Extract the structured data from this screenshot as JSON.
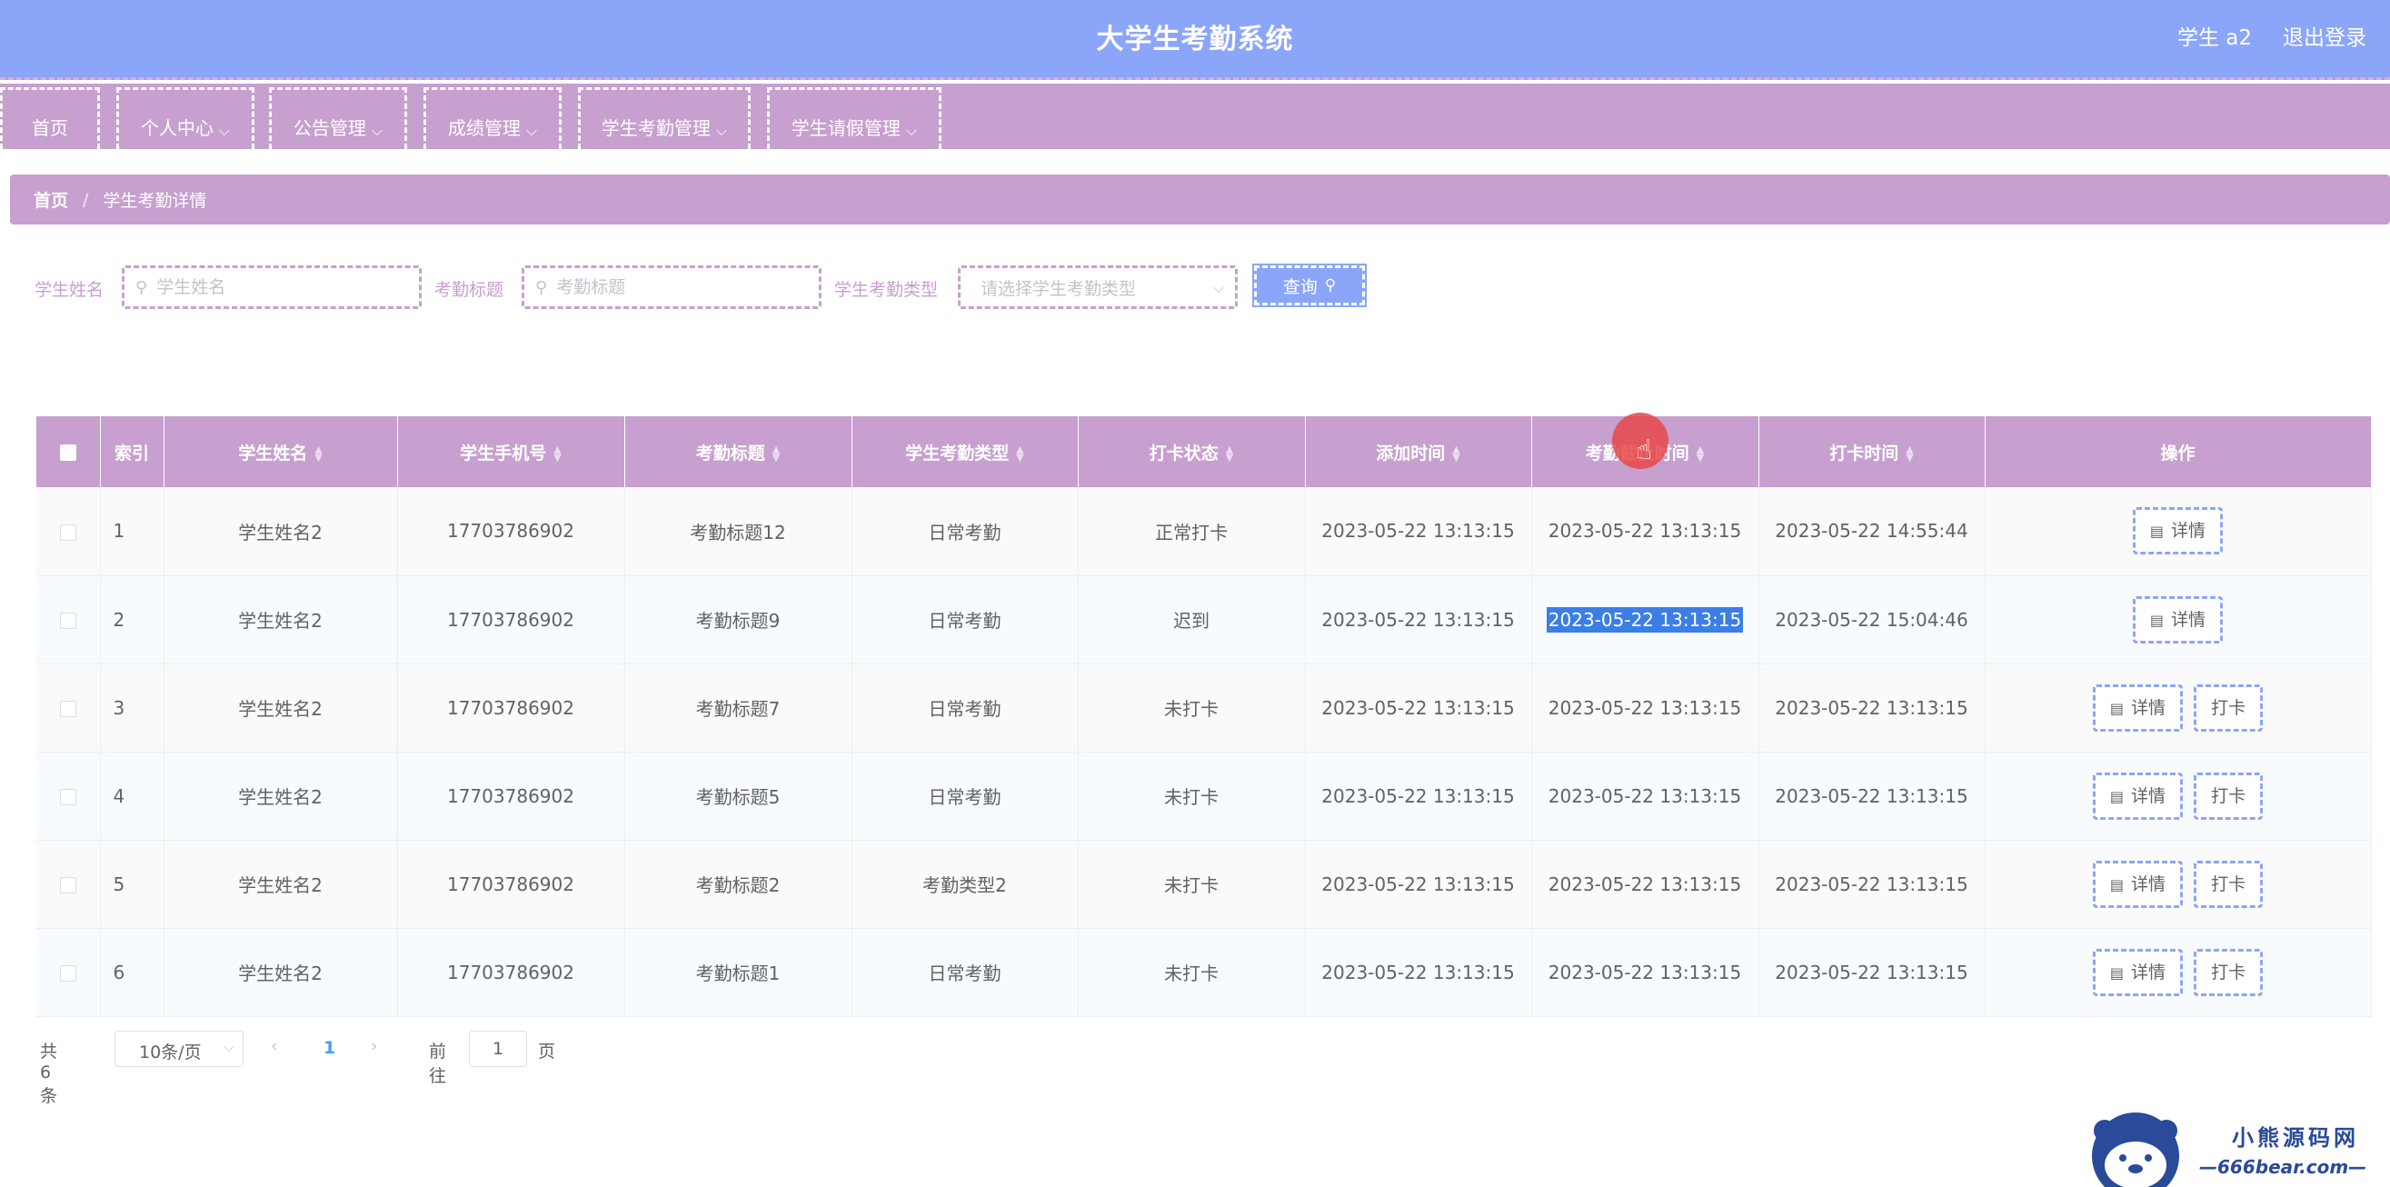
{
  "header": {
    "title": "大学生考勤系统",
    "user": "学生 a2",
    "logout": "退出登录"
  },
  "nav": {
    "items": [
      {
        "label": "首页",
        "dropdown": false
      },
      {
        "label": "个人中心",
        "dropdown": true
      },
      {
        "label": "公告管理",
        "dropdown": true
      },
      {
        "label": "成绩管理",
        "dropdown": true
      },
      {
        "label": "学生考勤管理",
        "dropdown": true
      },
      {
        "label": "学生请假管理",
        "dropdown": true
      }
    ]
  },
  "breadcrumb": {
    "home": "首页",
    "separator": "/",
    "current": "学生考勤详情"
  },
  "search": {
    "name_label": "学生姓名",
    "name_placeholder": "学生姓名",
    "title_label": "考勤标题",
    "title_placeholder": "考勤标题",
    "type_label": "学生考勤类型",
    "type_placeholder": "请选择学生考勤类型",
    "query_button": "查询"
  },
  "table": {
    "columns": [
      "索引",
      "学生姓名",
      "学生手机号",
      "考勤标题",
      "学生考勤类型",
      "打卡状态",
      "添加时间",
      "考勤截止时间",
      "打卡时间",
      "操作"
    ],
    "rows": [
      {
        "index": "1",
        "name": "学生姓名2",
        "phone": "17703786902",
        "title": "考勤标题12",
        "type": "日常考勤",
        "status": "正常打卡",
        "added": "2023-05-22 13:13:15",
        "deadline": "2023-05-22 13:13:15",
        "punch_time": "2023-05-22 14:55:44",
        "actions": [
          "详情"
        ]
      },
      {
        "index": "2",
        "name": "学生姓名2",
        "phone": "17703786902",
        "title": "考勤标题9",
        "type": "日常考勤",
        "status": "迟到",
        "added": "2023-05-22 13:13:15",
        "deadline": "2023-05-22 13:13:15",
        "punch_time": "2023-05-22 15:04:46",
        "actions": [
          "详情"
        ]
      },
      {
        "index": "3",
        "name": "学生姓名2",
        "phone": "17703786902",
        "title": "考勤标题7",
        "type": "日常考勤",
        "status": "未打卡",
        "added": "2023-05-22 13:13:15",
        "deadline": "2023-05-22 13:13:15",
        "punch_time": "2023-05-22 13:13:15",
        "actions": [
          "详情",
          "打卡"
        ]
      },
      {
        "index": "4",
        "name": "学生姓名2",
        "phone": "17703786902",
        "title": "考勤标题5",
        "type": "日常考勤",
        "status": "未打卡",
        "added": "2023-05-22 13:13:15",
        "deadline": "2023-05-22 13:13:15",
        "punch_time": "2023-05-22 13:13:15",
        "actions": [
          "详情",
          "打卡"
        ]
      },
      {
        "index": "5",
        "name": "学生姓名2",
        "phone": "17703786902",
        "title": "考勤标题2",
        "type": "考勤类型2",
        "status": "未打卡",
        "added": "2023-05-22 13:13:15",
        "deadline": "2023-05-22 13:13:15",
        "punch_time": "2023-05-22 13:13:15",
        "actions": [
          "详情",
          "打卡"
        ]
      },
      {
        "index": "6",
        "name": "学生姓名2",
        "phone": "17703786902",
        "title": "考勤标题1",
        "type": "日常考勤",
        "status": "未打卡",
        "added": "2023-05-22 13:13:15",
        "deadline": "2023-05-22 13:13:15",
        "punch_time": "2023-05-22 13:13:15",
        "actions": [
          "详情",
          "打卡"
        ]
      }
    ]
  },
  "pagination": {
    "total": "共 6 条",
    "page_size": "10条/页",
    "current_page": "1",
    "goto_label": "前往",
    "goto_value": "1",
    "page_word": "页"
  },
  "watermark": {
    "cn": "小熊源码网",
    "en": "—666bear.com—"
  },
  "colors": {
    "header": "#8ba6f8",
    "nav": "#c7a0cf",
    "selection": "#3b7ee6",
    "cursor": "#e84848"
  },
  "icons": [
    "search-icon",
    "chevron-down-icon",
    "sort-caret-icon",
    "document-icon",
    "hand-pointer-icon"
  ]
}
